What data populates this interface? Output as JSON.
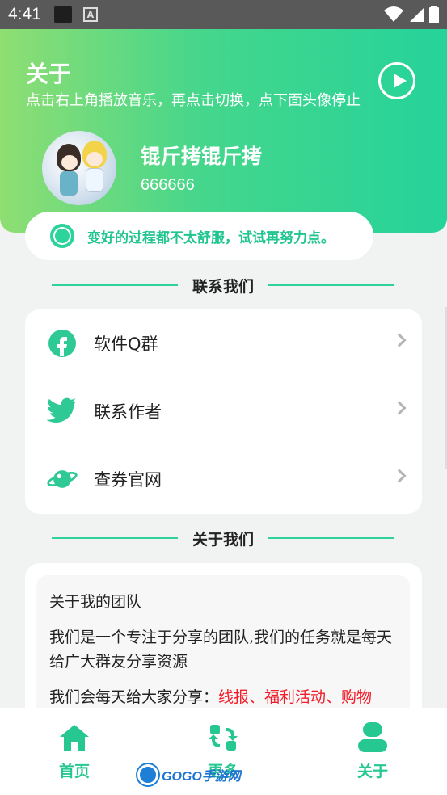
{
  "status_bar": {
    "time": "4:41",
    "notif_icon": "A"
  },
  "header": {
    "title": "关于",
    "subtitle": "点击右上角播放音乐，再点击切换，点下面头像停止",
    "play_icon": "play-circle-icon",
    "gradient": [
      "#8fde72",
      "#25d39a"
    ]
  },
  "profile": {
    "name": "锟斤拷锟斤拷",
    "id": "666666"
  },
  "motto": {
    "text": "变好的过程都不太舒服，试试再努力点。"
  },
  "contact_section": {
    "heading": "联系我们",
    "items": [
      {
        "label": "软件Q群",
        "icon": "facebook-icon"
      },
      {
        "label": "联系作者",
        "icon": "twitter-icon"
      },
      {
        "label": "查券官网",
        "icon": "planet-icon"
      }
    ]
  },
  "about_section": {
    "heading": "关于我们",
    "paragraphs": [
      "关于我的团队",
      "我们是一个专注于分享的团队,我们的任务就是每天给广大群友分享资源"
    ],
    "partial_line": {
      "prefix": "我们会每天给大家分享：",
      "highlight": "线报、福利活动、购物"
    }
  },
  "tabbar": {
    "tabs": [
      {
        "label": "首页",
        "icon": "home-icon"
      },
      {
        "label": "更多",
        "icon": "refresh-icon"
      },
      {
        "label": "关于",
        "icon": "person-icon"
      }
    ]
  },
  "watermark": {
    "text": "GOGO手游网"
  },
  "colors": {
    "accent": "#26c790",
    "highlight_red": "#f21c2a",
    "status_bar": "#595959"
  }
}
